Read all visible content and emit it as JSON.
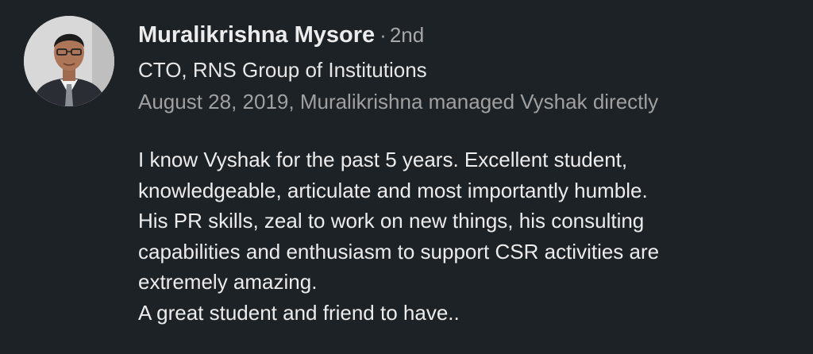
{
  "recommender": {
    "avatar_icon": "profile-photo",
    "name": "Muralikrishna Mysore",
    "separator": "·",
    "degree": "2nd",
    "headline": "CTO, RNS Group of Institutions",
    "meta": "August 28, 2019, Muralikrishna managed Vyshak directly"
  },
  "recommendation": {
    "lines": [
      "I know Vyshak for the past 5 years. Excellent student,",
      "knowledgeable, articulate and most importantly humble.",
      "His PR skills, zeal to work on new things, his consulting",
      "capabilities and enthusiasm to support CSR activities are",
      "extremely amazing.",
      "A great student and friend to have.."
    ]
  },
  "colors": {
    "background": "#1d2226",
    "primary_text": "#ececec",
    "secondary_text": "#a0a0a0"
  }
}
